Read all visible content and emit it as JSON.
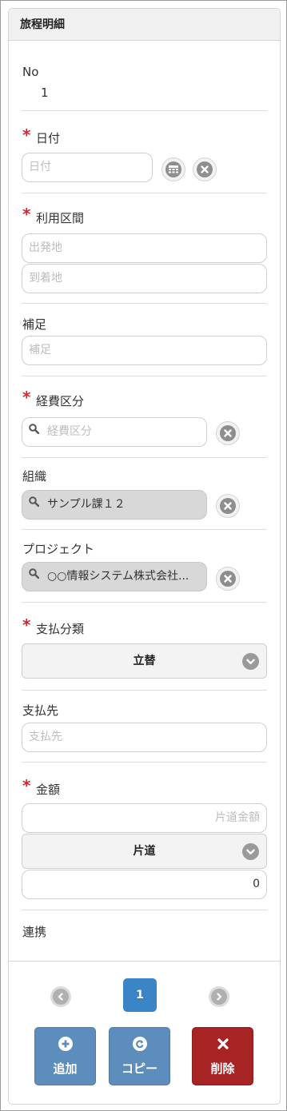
{
  "header": {
    "title": "旅程明細"
  },
  "no": {
    "label": "No",
    "value": "1"
  },
  "date": {
    "label": "日付",
    "placeholder": "日付"
  },
  "route": {
    "label": "利用区間",
    "from_placeholder": "出発地",
    "to_placeholder": "到着地"
  },
  "note": {
    "label": "補足",
    "placeholder": "補足"
  },
  "expense_category": {
    "label": "経費区分",
    "placeholder": "経費区分"
  },
  "organization": {
    "label": "組織",
    "value": "サンプル課１２"
  },
  "project": {
    "label": "プロジェクト",
    "value": "○○情報システム株式会社..."
  },
  "payment_type": {
    "label": "支払分類",
    "selected": "立替"
  },
  "payee": {
    "label": "支払先",
    "placeholder": "支払先"
  },
  "amount": {
    "label": "金額",
    "oneway_placeholder": "片道金額",
    "trip_selected": "片道",
    "total_value": "0"
  },
  "linkage": {
    "label": "連携"
  },
  "pager": {
    "current": "1"
  },
  "actions": {
    "add": "追加",
    "copy": "コピー",
    "delete": "削除"
  },
  "colors": {
    "required": "#d9232d",
    "primary": "#3b85c7",
    "button_blue": "#5d8dbd",
    "danger": "#a82424"
  },
  "icons": [
    "calendar-icon",
    "clear-icon",
    "search-icon",
    "chevron-down-icon",
    "chevron-left-icon",
    "chevron-right-icon",
    "plus-icon",
    "redo-icon",
    "close-icon"
  ]
}
